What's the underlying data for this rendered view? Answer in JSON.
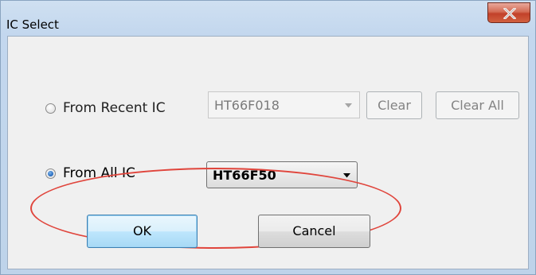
{
  "window": {
    "title": "IC Select",
    "close_label": "X"
  },
  "recent": {
    "label": "From Recent IC",
    "selected": false,
    "combo_value": "HT66F018",
    "combo_enabled": false,
    "clear_label": "Clear",
    "clear_all_label": "Clear All"
  },
  "all": {
    "label": "From All IC",
    "selected": true,
    "combo_value": "HT66F50",
    "combo_enabled": true
  },
  "buttons": {
    "ok_label": "OK",
    "cancel_label": "Cancel"
  },
  "annotation": {
    "highlight_color": "#e0453c"
  }
}
